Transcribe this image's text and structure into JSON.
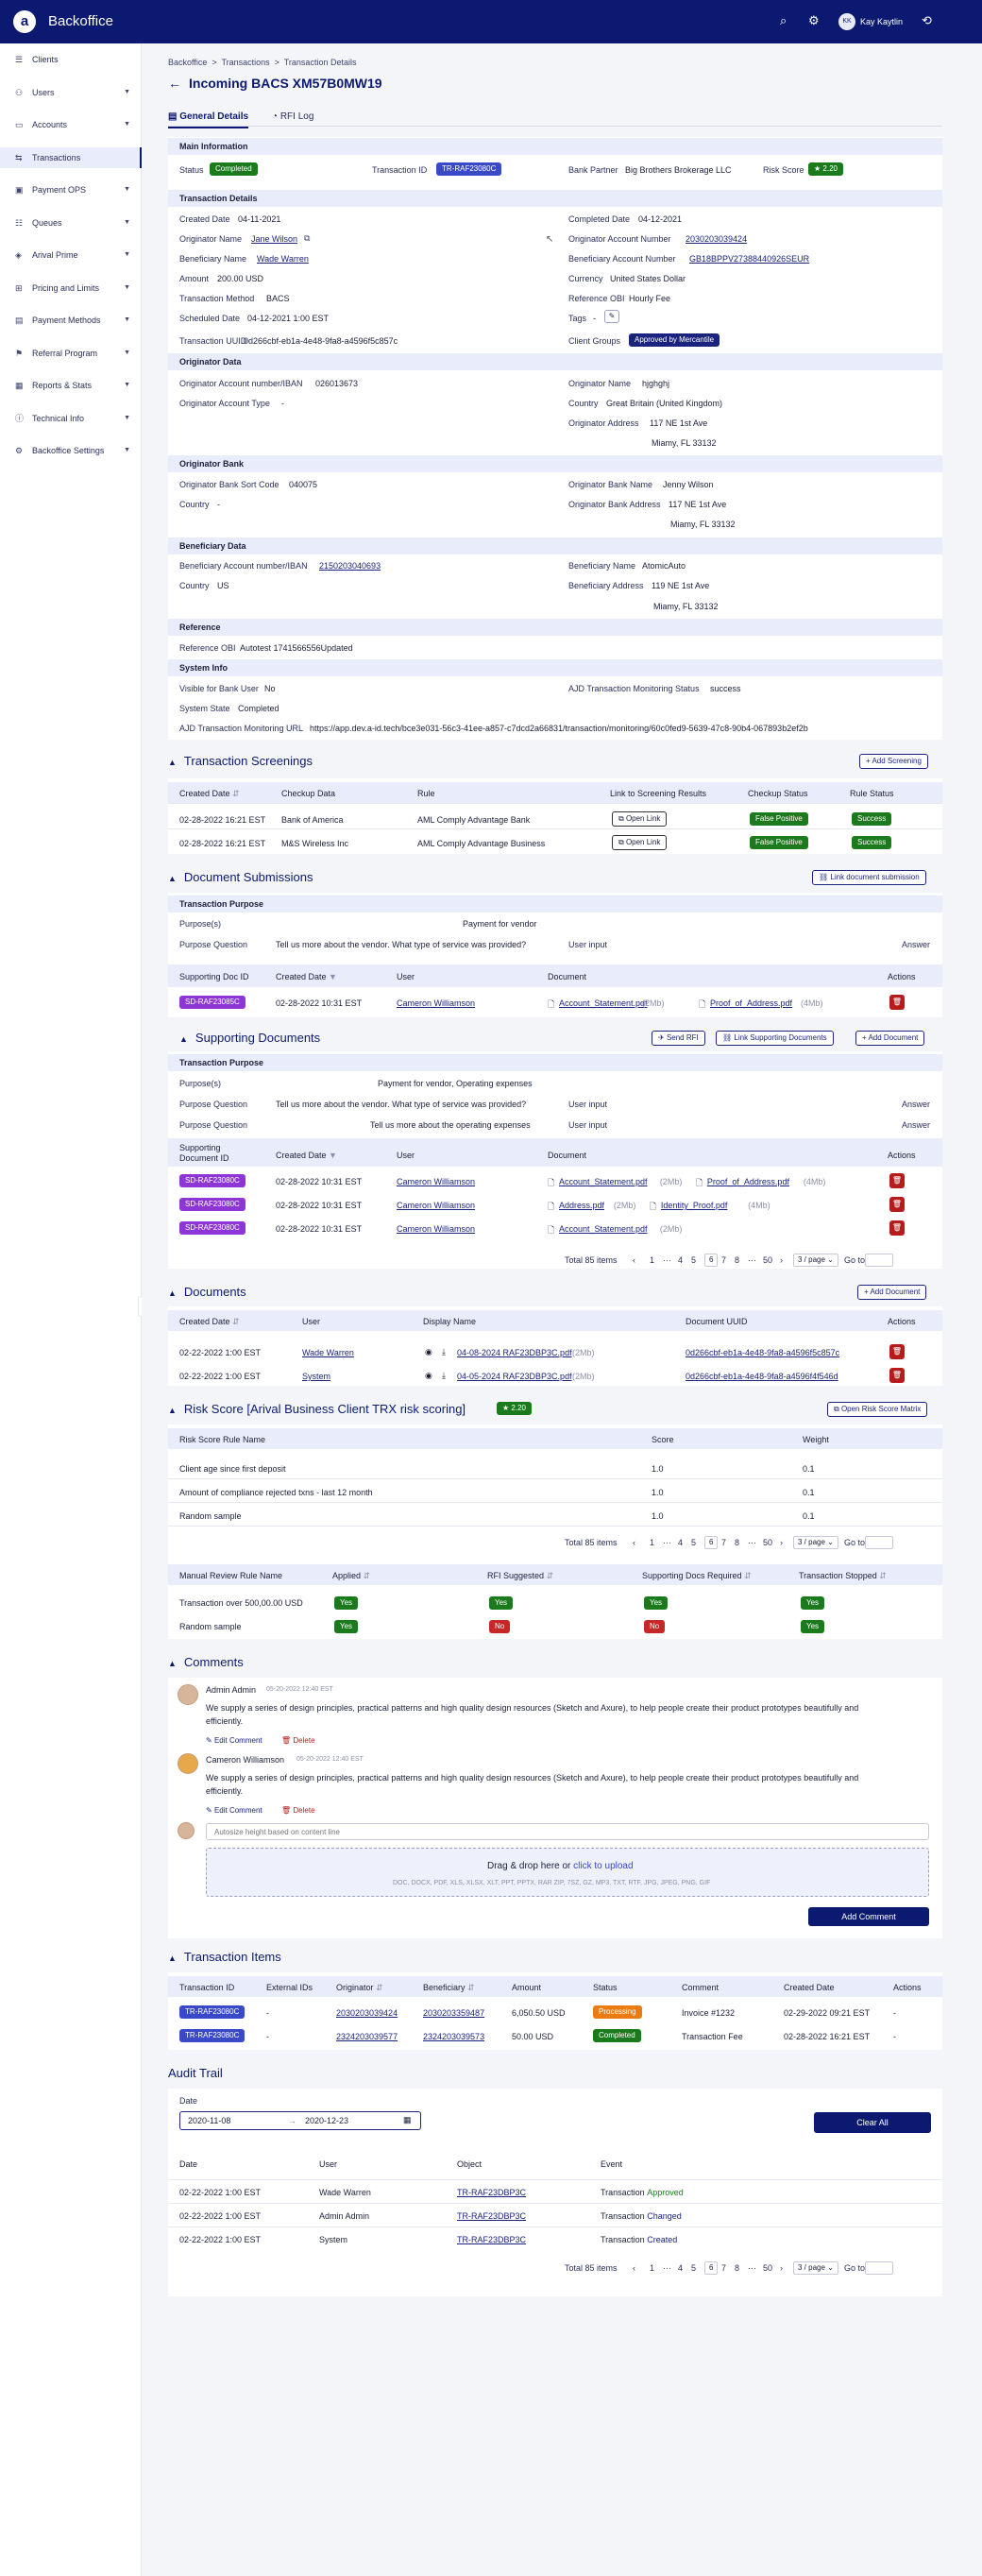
{
  "app": {
    "title": "Backoffice",
    "user": "Kay Kaytlin",
    "user_initials": "KK",
    "icons": [
      "search-icon",
      "gear-icon",
      "user-avatar",
      "logout-icon"
    ]
  },
  "sidebar": {
    "items": [
      {
        "label": "Clients",
        "icon": "clients-icon",
        "chev": false
      },
      {
        "label": "Users",
        "icon": "users-icon",
        "chev": true
      },
      {
        "label": "Accounts",
        "icon": "accounts-icon",
        "chev": true
      },
      {
        "label": "Transactions",
        "icon": "transactions-icon",
        "chev": false,
        "active": true
      },
      {
        "label": "Payment OPS",
        "icon": "payment-ops-icon",
        "chev": true
      },
      {
        "label": "Queues",
        "icon": "queues-icon",
        "chev": true
      },
      {
        "label": "Arival Prime",
        "icon": "prime-icon",
        "chev": true
      },
      {
        "label": "Pricing and Limits",
        "icon": "pricing-icon",
        "chev": true
      },
      {
        "label": "Payment Methods",
        "icon": "payment-methods-icon",
        "chev": true
      },
      {
        "label": "Referral Program",
        "icon": "referral-icon",
        "chev": true
      },
      {
        "label": "Reports & Stats",
        "icon": "reports-icon",
        "chev": true
      },
      {
        "label": "Technical Info",
        "icon": "technical-icon",
        "chev": true
      },
      {
        "label": "Backoffice Settings",
        "icon": "settings-icon",
        "chev": true
      }
    ]
  },
  "breadcrumb": [
    "Backoffice",
    "Transactions",
    "Transaction Details"
  ],
  "page_title": "Incoming BACS XM57B0MW19",
  "tabs": [
    "General Details",
    "RFI Log"
  ],
  "main_info": {
    "title": "Main Information",
    "status_label": "Status",
    "status": "Completed",
    "txid_label": "Transaction ID",
    "txid": "TR-RAF23080C",
    "bank_partner_label": "Bank Partner",
    "bank_partner": "Big Brothers Brokerage LLC",
    "risk_label": "Risk Score",
    "risk": "2.20"
  },
  "details": {
    "title": "Transaction Details",
    "created_label": "Created Date",
    "created": "04-11-2021",
    "completed_label": "Completed Date",
    "completed": "04-12-2021",
    "orig_name_label": "Originator Name",
    "orig_name": "Jane Wilson",
    "orig_acc_label": "Originator Account Number",
    "orig_acc": "2030203039424",
    "ben_name_label": "Beneficiary Name",
    "ben_name": "Wade Warren",
    "ben_acc_label": "Beneficiary Account Number",
    "ben_acc": "GB18BPPV27388440926SEUR",
    "amount_label": "Amount",
    "amount": "200.00 USD",
    "currency_label": "Currency",
    "currency": "United States Dollar",
    "method_label": "Transaction Method",
    "method": "BACS",
    "ref_obi_label": "Reference OBI",
    "ref_obi": "Hourly Fee",
    "sched_label": "Scheduled Date",
    "sched": "04-12-2021 1:00 EST",
    "tags_label": "Tags",
    "tags": "-",
    "uuid_label": "Transaction UUID",
    "uuid": "0d266cbf-eb1a-4e48-9fa8-a4596f5c857c",
    "groups_label": "Client Groups",
    "groups": "Approved by Mercantile"
  },
  "orig_data": {
    "title": "Originator Data",
    "acc_iban_label": "Originator Account number/IBAN",
    "acc_iban": "026013673",
    "name_label": "Originator Name",
    "name": "hjghghj",
    "type_label": "Originator Account Type",
    "type": "-",
    "country_label": "Country",
    "country": "Great Britain (United Kingdom)",
    "addr_label": "Originator Address",
    "addr1": "117 NE 1st Ave",
    "addr2": "Miamy, FL 33132"
  },
  "orig_bank": {
    "title": "Originator Bank",
    "sort_label": "Originator Bank Sort Code",
    "sort": "040075",
    "bname_label": "Originator Bank Name",
    "bname": "Jenny Wilson",
    "country_label": "Country",
    "country": "-",
    "baddr_label": "Originator Bank Address",
    "baddr1": "117 NE 1st Ave",
    "baddr2": "Miamy, FL 33132"
  },
  "ben_data": {
    "title": "Beneficiary Data",
    "acc_label": "Beneficiary Account number/IBAN",
    "acc": "2150203040693",
    "name_label": "Beneficiary Name",
    "name": "AtomicAuto",
    "country_label": "Country",
    "country": "US",
    "addr_label": "Beneficiary Address",
    "addr1": "119 NE 1st Ave",
    "addr2": "Miamy, FL 33132"
  },
  "reference": {
    "title": "Reference",
    "obi_label": "Reference OBI",
    "obi": "Autotest 1741566556Updated"
  },
  "system_info": {
    "title": "System Info",
    "visible_label": "Visible for Bank User",
    "visible": "No",
    "ajd_label": "AJD Transaction Monitoring Status",
    "ajd": "success",
    "state_label": "System State",
    "state": "Completed",
    "url_label": "AJD Transaction Monitoring URL",
    "url": "https://app.dev.a-id.tech/bce3e031-56c3-41ee-a857-c7dcd2a66831/transaction/monitoring/60c0fed9-5639-47c8-90b4-067893b2ef2b"
  },
  "screenings": {
    "title": "Transaction Screenings",
    "add": "Add Screening",
    "headers": [
      "Created Date",
      "Checkup Data",
      "Rule",
      "Link to Screening Results",
      "Checkup Status",
      "Rule Status"
    ],
    "rows": [
      {
        "date": "02-28-2022 16:21 EST",
        "data": "Bank of America",
        "rule": "AML Comply Advantage Bank",
        "link": "Open Link",
        "checkup": "False Positive",
        "status": "Success"
      },
      {
        "date": "02-28-2022 16:21 EST",
        "data": "M&S Wireless Inc",
        "rule": "AML Comply Advantage Business",
        "link": "Open Link",
        "checkup": "False Positive",
        "status": "Success"
      }
    ]
  },
  "doc_subs": {
    "title": "Document Submissions",
    "link": "Link document submission",
    "purpose_title": "Transaction Purpose",
    "purpose_label": "Purpose(s)",
    "purpose": "Payment for vendor",
    "question_label": "Purpose Question",
    "question": "Tell us more about the vendor. What type of service was provided?",
    "input_label": "User input",
    "answer_label": "Answer",
    "headers": [
      "Supporting Doc ID",
      "Created Date",
      "User",
      "Document",
      "Actions"
    ],
    "rows": [
      {
        "id": "SD-RAF23085C",
        "date": "02-28-2022 10:31 EST",
        "user": "Cameron Williamson",
        "doc1": "Account_Statement.pdf",
        "doc1_size": "(2Mb)",
        "doc2": "Proof_of_Address.pdf",
        "doc2_size": "(4Mb)"
      }
    ]
  },
  "supporting": {
    "title": "Supporting Documents",
    "send_rfi": "Send RFI",
    "link": "Link Supporting Documents",
    "add": "Add Document",
    "purpose_title": "Transaction Purpose",
    "purpose_label": "Purpose(s)",
    "purpose": "Payment for vendor, Operating expenses",
    "q1_label": "Purpose Question",
    "q1": "Tell us more about the vendor. What type of service was provided?",
    "q2_label": "Purpose Question",
    "q2": "Tell us more about the operating expenses",
    "input_label": "User input",
    "answer_label": "Answer",
    "headers": [
      "Supporting Document ID",
      "Created Date",
      "User",
      "Document",
      "Actions"
    ],
    "rows": [
      {
        "id": "SD-RAF23080C",
        "date": "02-28-2022 10:31 EST",
        "user": "Cameron Williamson",
        "doc1": "Account_Statement.pdf",
        "doc1_size": "(2Mb)",
        "doc2": "Proof_of_Address.pdf",
        "doc2_size": "(4Mb)"
      },
      {
        "id": "SD-RAF23080C",
        "date": "02-28-2022 10:31 EST",
        "user": "Cameron Williamson",
        "doc1": "Address.pdf",
        "doc1_size": "(2Mb)",
        "doc2": "Identity_Proof.pdf",
        "doc2_size": "(4Mb)"
      },
      {
        "id": "SD-RAF23080C",
        "date": "02-28-2022 10:31 EST",
        "user": "Cameron Williamson",
        "doc1": "Account_Statement.pdf",
        "doc1_size": "(2Mb)",
        "doc2": "",
        "doc2_size": ""
      }
    ]
  },
  "pagination": {
    "total": "Total 85 items",
    "pages": [
      "1",
      "···",
      "4",
      "5",
      "6",
      "7",
      "8",
      "···",
      "50"
    ],
    "current": "6",
    "per_page": "3 / page",
    "goto": "Go to"
  },
  "documents": {
    "title": "Documents",
    "add": "Add Document",
    "headers": [
      "Created Date",
      "User",
      "Display Name",
      "Document UUID",
      "Actions"
    ],
    "rows": [
      {
        "date": "02-22-2022 1:00 EST",
        "user": "Wade Warren",
        "name": "04-08-2024 RAF23DBP3C.pdf",
        "size": "(2Mb)",
        "uuid": "0d266cbf-eb1a-4e48-9fa8-a4596f5c857c"
      },
      {
        "date": "02-22-2022 1:00 EST",
        "user": "System",
        "name": "04-05-2024 RAF23DBP3C.pdf",
        "size": "(2Mb)",
        "uuid": "0d266cbf-eb1a-4e48-9fa8-a4596f4f546d"
      }
    ]
  },
  "risk": {
    "title": "Risk Score [Arival Business Client TRX risk scoring]",
    "score": "2.20",
    "open": "Open Risk Score Matrix",
    "headers": [
      "Risk Score Rule Name",
      "Score",
      "Weight"
    ],
    "rows": [
      {
        "name": "Client age since first deposit",
        "score": "1.0",
        "weight": "0.1"
      },
      {
        "name": "Amount of compliance rejected txns - last 12 month",
        "score": "1.0",
        "weight": "0.1"
      },
      {
        "name": "Random sample",
        "score": "1.0",
        "weight": "0.1"
      }
    ],
    "manual_headers": [
      "Manual Review Rule Name",
      "Applied",
      "RFI Suggested",
      "Supporting Docs Required",
      "Transaction Stopped"
    ],
    "manual_rows": [
      {
        "name": "Transaction over 500,00.00 USD",
        "applied": "Yes",
        "rfi": "Yes",
        "docs": "Yes",
        "stopped": "Yes"
      },
      {
        "name": "Random sample",
        "applied": "Yes",
        "rfi": "No",
        "docs": "No",
        "stopped": "Yes"
      }
    ]
  },
  "comments": {
    "title": "Comments",
    "items": [
      {
        "author": "Admin Admin",
        "time": "05-20-2022 12:40 EST",
        "text": "We supply a series of design principles, practical patterns and high quality design resources (Sketch and Axure), to help people create their product prototypes beautifully and efficiently.",
        "edit": "Edit Comment",
        "delete": "Delete"
      },
      {
        "author": "Cameron Williamson",
        "time": "05-20-2022 12:40 EST",
        "text": "We supply a series of design principles, practical patterns and high quality design resources (Sketch and Axure), to help people create their product prototypes beautifully and efficiently.",
        "edit": "Edit Comment",
        "delete": "Delete"
      }
    ],
    "placeholder": "Autosize height based on content line",
    "upload_text": "Drag & drop here or",
    "upload_link": "click to upload",
    "upload_formats": "DOC, DOCX, PDF, XLS, XLSX, XLT, PPT, PPTX, RAR ZIP, 7SZ, GZ, MP3, TXT, RTF, JPG, JPEG, PNG, GIF",
    "add": "Add Comment"
  },
  "items": {
    "title": "Transaction Items",
    "headers": [
      "Transaction ID",
      "External IDs",
      "Originator",
      "Beneficiary",
      "Amount",
      "Status",
      "Comment",
      "Created Date",
      "Actions"
    ],
    "rows": [
      {
        "id": "TR-RAF23080C",
        "ext": "-",
        "orig": "2030203039424",
        "ben": "2030203359487",
        "amount": "6,050.50 USD",
        "status": "Processing",
        "comment": "Invoice #1232",
        "date": "02-29-2022 09:21 EST",
        "actions": "-"
      },
      {
        "id": "TR-RAF23080C",
        "ext": "-",
        "orig": "2324203039577",
        "ben": "2324203039573",
        "amount": "50.00 USD",
        "status": "Completed",
        "comment": "Transaction Fee",
        "date": "02-28-2022 16:21 EST",
        "actions": "-"
      }
    ]
  },
  "audit": {
    "title": "Audit Trail",
    "date_label": "Date",
    "from": "2020-11-08",
    "to": "2020-12-23",
    "clear": "Clear All",
    "headers": [
      "Date",
      "User",
      "Object",
      "Event"
    ],
    "rows": [
      {
        "date": "02-22-2022 1:00 EST",
        "user": "Wade Warren",
        "object": "TR-RAF23DBP3C",
        "event": "Transaction",
        "event_word": "Approved"
      },
      {
        "date": "02-22-2022 1:00 EST",
        "user": "Admin Admin",
        "object": "TR-RAF23DBP3C",
        "event": "Transaction",
        "event_word": "Changed"
      },
      {
        "date": "02-22-2022 1:00 EST",
        "user": "System",
        "object": "TR-RAF23DBP3C",
        "event": "Transaction",
        "event_word": "Created"
      }
    ]
  }
}
